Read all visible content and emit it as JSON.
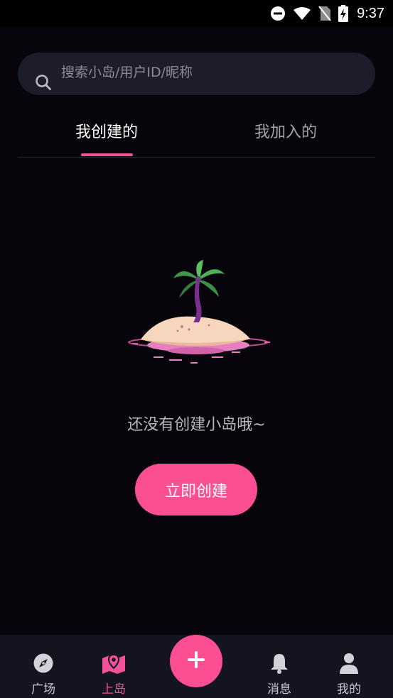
{
  "status_bar": {
    "time": "9:37",
    "icons": [
      "do-not-disturb-icon",
      "wifi-icon",
      "no-sim-icon",
      "battery-charging-icon"
    ]
  },
  "search": {
    "placeholder": "搜索小岛/用户ID/昵称",
    "value": ""
  },
  "tabs": [
    {
      "label": "我创建的",
      "active": true
    },
    {
      "label": "我加入的",
      "active": false
    }
  ],
  "empty_state": {
    "illustration": "island-palm-tree-illustration",
    "message": "还没有创建小岛哦~",
    "button_label": "立即创建"
  },
  "bottom_nav": {
    "items": [
      {
        "label": "广场",
        "icon": "compass-icon",
        "active": false
      },
      {
        "label": "上岛",
        "icon": "map-pin-icon",
        "active": true
      },
      {
        "label": "消息",
        "icon": "bell-icon",
        "active": false
      },
      {
        "label": "我的",
        "icon": "user-icon",
        "active": false
      }
    ],
    "fab_icon": "plus-icon"
  },
  "colors": {
    "background": "#07050b",
    "accent": "#fc4f93",
    "search_bg": "#1c1c2a",
    "nav_bg": "#141420"
  }
}
